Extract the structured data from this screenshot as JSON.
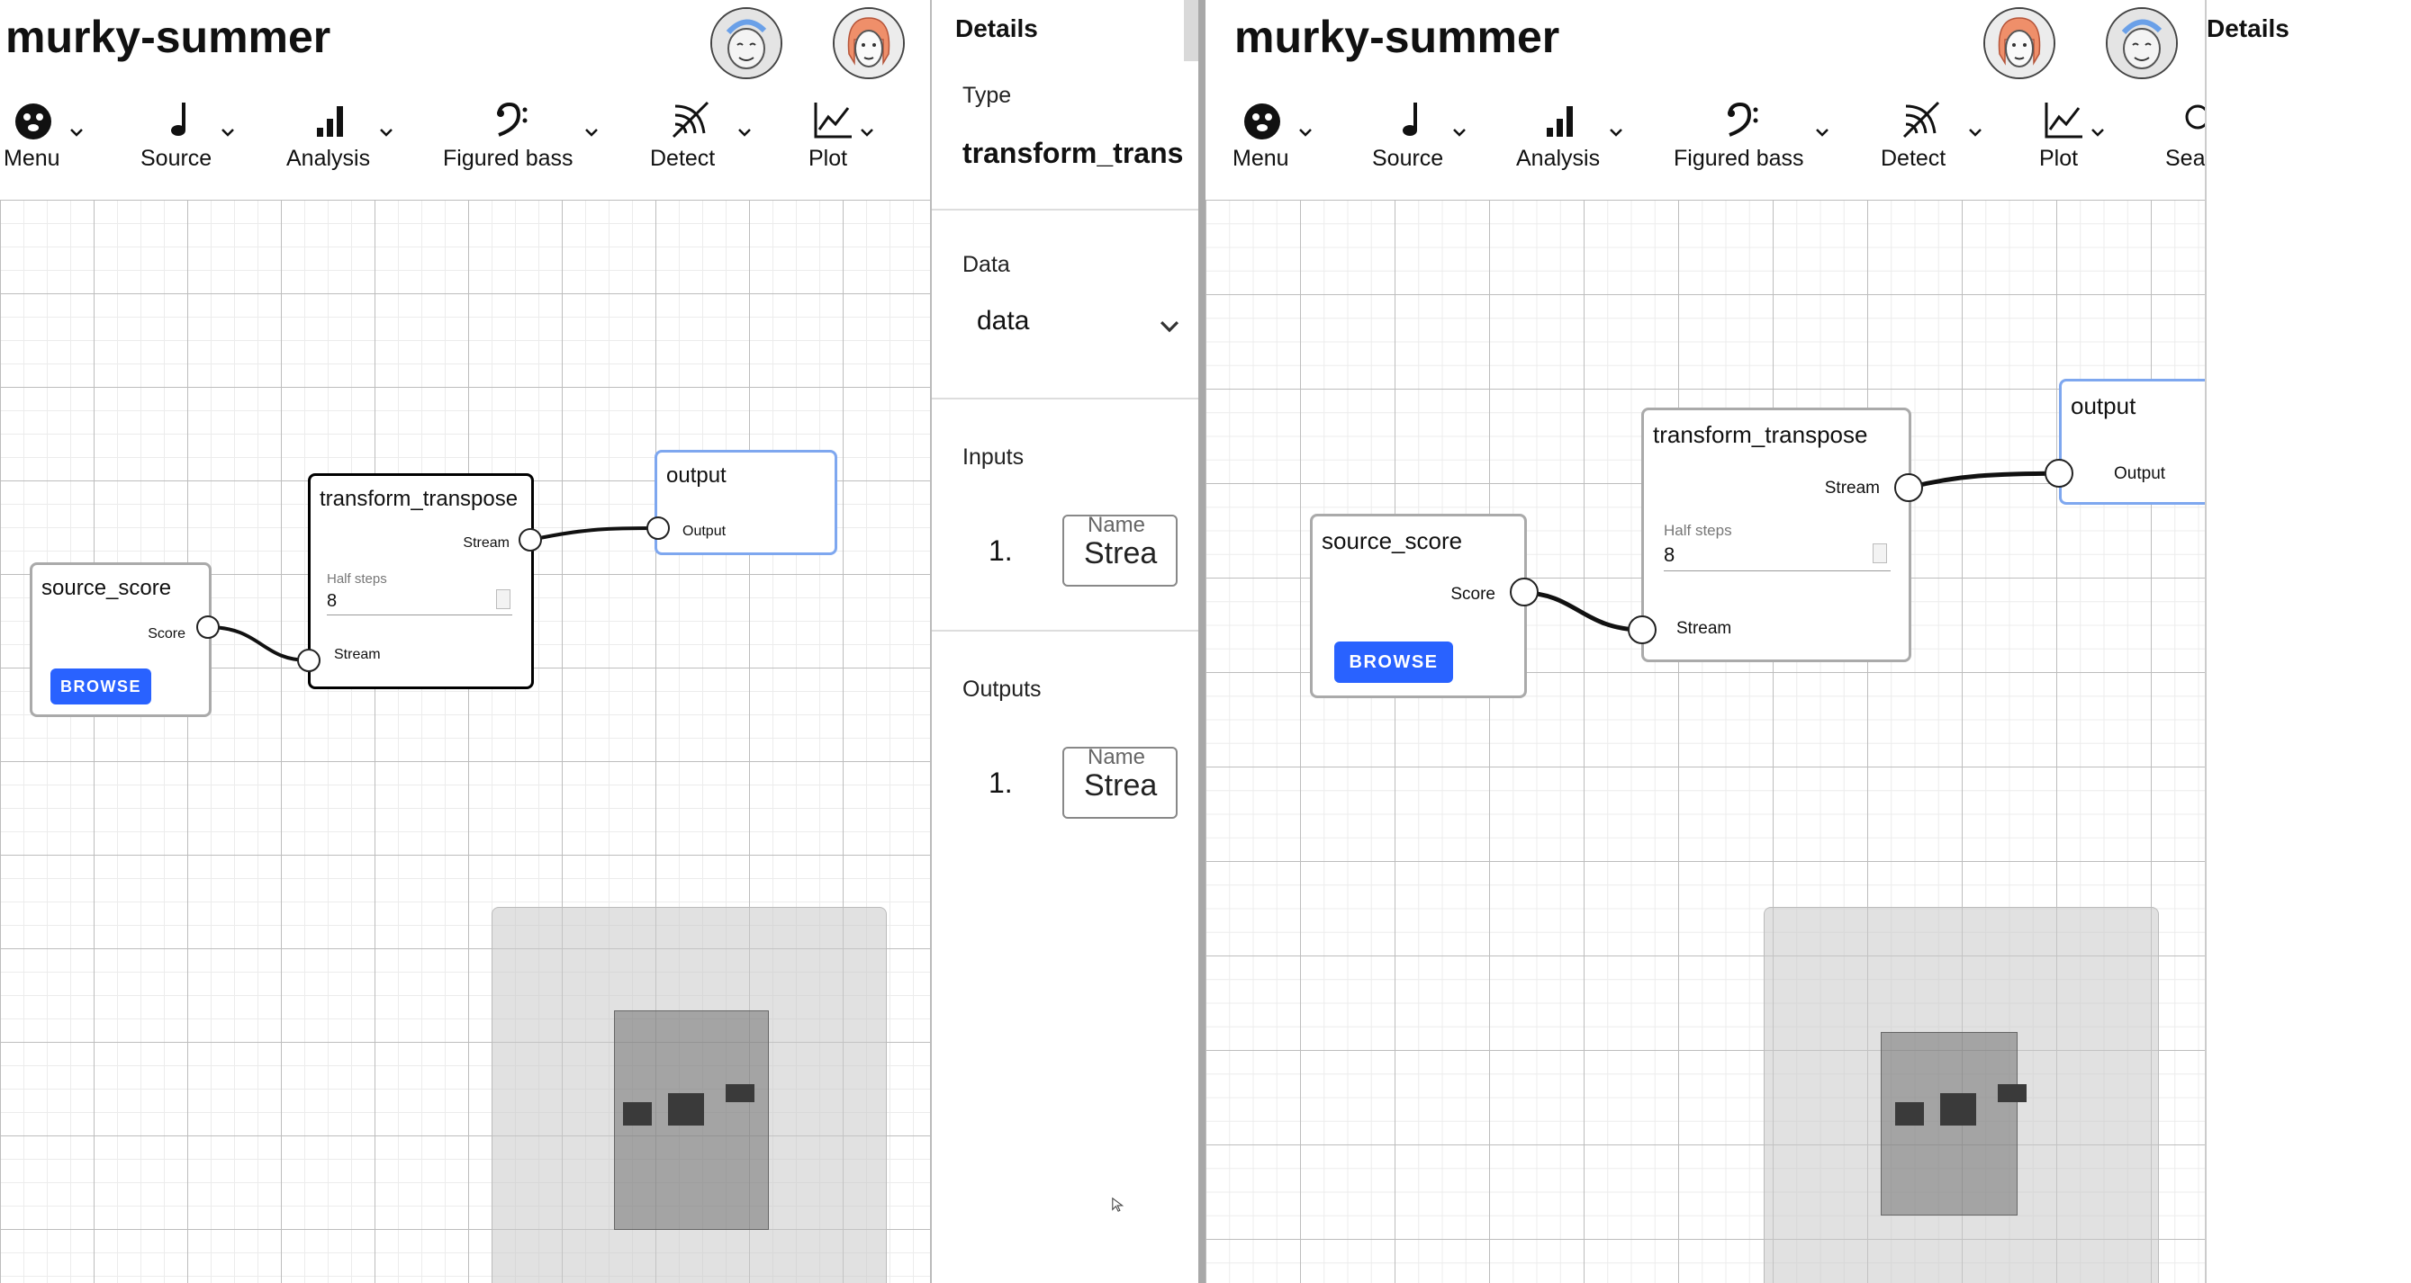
{
  "app": {
    "title": "murky-summer"
  },
  "toolbar": {
    "left": [
      {
        "label": "Menu",
        "icon": "bug-icon"
      },
      {
        "label": "Source",
        "icon": "music-note-icon"
      },
      {
        "label": "Analysis",
        "icon": "bar-chart-icon"
      },
      {
        "label": "Figured bass",
        "icon": "bass-clef-icon"
      },
      {
        "label": "Detect",
        "icon": "signal-icon"
      },
      {
        "label": "Plot",
        "icon": "line-chart-icon"
      }
    ],
    "right": [
      {
        "label": "Menu",
        "icon": "bug-icon"
      },
      {
        "label": "Source",
        "icon": "music-note-icon"
      },
      {
        "label": "Analysis",
        "icon": "bar-chart-icon"
      },
      {
        "label": "Figured bass",
        "icon": "bass-clef-icon"
      },
      {
        "label": "Detect",
        "icon": "signal-icon"
      },
      {
        "label": "Plot",
        "icon": "line-chart-icon"
      },
      {
        "label": "Sea",
        "icon": "search-icon"
      }
    ]
  },
  "nodes": {
    "source": {
      "title": "source_score",
      "port_label": "Score",
      "button": "BROWSE"
    },
    "transform": {
      "title": "transform_transpose",
      "out_label": "Stream",
      "in_label": "Stream",
      "field_label": "Half steps",
      "field_value": "8"
    },
    "output": {
      "title": "output",
      "port_label": "Output"
    }
  },
  "details_left": {
    "title": "Details",
    "type_label": "Type",
    "type_value": "transform_trans",
    "data_label": "Data",
    "data_value": "data",
    "inputs_label": "Inputs",
    "outputs_label": "Outputs",
    "inputs": [
      {
        "index": "1.",
        "name_label": "Name",
        "name_value": "Strea"
      }
    ],
    "outputs": [
      {
        "index": "1.",
        "name_label": "Name",
        "name_value": "Strea"
      }
    ]
  },
  "details_right": {
    "title": "Details"
  },
  "colors": {
    "accent": "#2962ff",
    "output_border": "#7ea7ef",
    "selected_border": "#000000"
  }
}
